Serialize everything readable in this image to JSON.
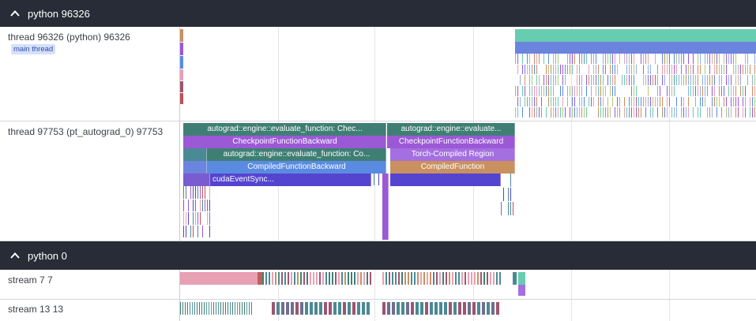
{
  "process_headers": [
    {
      "title": "python 96326"
    },
    {
      "title": "python 0"
    }
  ],
  "tracks": {
    "thread_main": {
      "label": "thread 96326 (python) 96326",
      "badge": "main thread"
    },
    "thread_autograd": {
      "label": "thread 97753 (pt_autograd_0) 97753"
    },
    "stream_7": {
      "label": "stream 7 7"
    },
    "stream_13": {
      "label": "stream 13 13"
    }
  },
  "slices": {
    "evaluate_function_1": "autograd::engine::evaluate_function: Chec...",
    "evaluate_function_2": "autograd::engine::evaluate...",
    "checkpoint_backward_1": "CheckpointFunctionBackward",
    "checkpoint_backward_2": "CheckpointFunctionBackward",
    "evaluate_function_compiled": "autograd::engine::evaluate_function: Co...",
    "torch_compiled_region": "Torch-Compiled Region",
    "compiled_function_backward": "CompiledFunctionBackward",
    "compiled_function": "CompiledFunction",
    "cuda_event_sync": "cudaEventSync..."
  },
  "colors": {
    "header_bg": "#272c36",
    "teal_dark": "#3f7f73",
    "teal_light": "#66cdb0",
    "purple": "#9b59d6",
    "blue": "#5b8be0",
    "indigo": "#5544d0",
    "tan": "#c99060",
    "pink": "#e8a0b4",
    "slate_teal": "#4a8a95",
    "mauve": "#9e5570"
  }
}
